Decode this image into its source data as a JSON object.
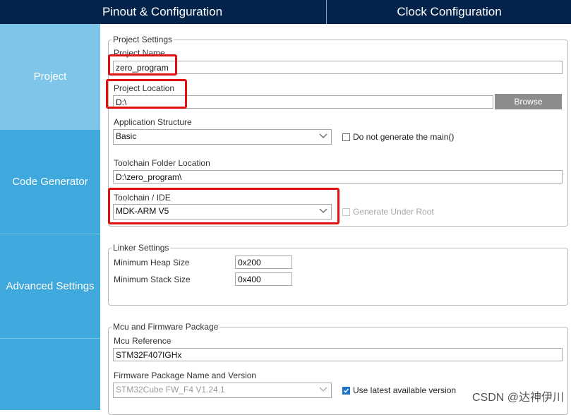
{
  "tabs": {
    "pinout": "Pinout & Configuration",
    "clock": "Clock Configuration"
  },
  "sidebar": {
    "items": [
      {
        "label": "Project"
      },
      {
        "label": "Code Generator"
      },
      {
        "label": "Advanced Settings"
      }
    ]
  },
  "project_settings": {
    "legend": "Project Settings",
    "name_label": "Project Name",
    "name_value": "zero_program",
    "location_label": "Project Location",
    "location_value": "D:\\",
    "browse_label": "Browse",
    "app_structure_label": "Application Structure",
    "app_structure_value": "Basic",
    "no_main_label": "Do not generate the main()",
    "toolchain_folder_label": "Toolchain Folder Location",
    "toolchain_folder_value": "D:\\zero_program\\",
    "toolchain_label": "Toolchain / IDE",
    "toolchain_value": "MDK-ARM V5",
    "gen_under_root_label": "Generate Under Root"
  },
  "linker_settings": {
    "legend": "Linker Settings",
    "heap_label": "Minimum Heap Size",
    "heap_value": "0x200",
    "stack_label": "Minimum Stack Size",
    "stack_value": "0x400"
  },
  "mcu_firmware": {
    "legend": "Mcu and Firmware Package",
    "mcu_ref_label": "Mcu Reference",
    "mcu_ref_value": "STM32F407IGHx",
    "fw_label": "Firmware Package Name and Version",
    "fw_value": "STM32Cube FW_F4 V1.24.1",
    "use_latest_label": "Use latest available version",
    "use_latest_checked": true
  },
  "watermark": "CSDN @达神伊川",
  "colors": {
    "header_bg": "#03234b",
    "sidebar_bg": "#3fa9dd",
    "sidebar_selected": "#7ec5ea",
    "highlight": "#e01010"
  }
}
